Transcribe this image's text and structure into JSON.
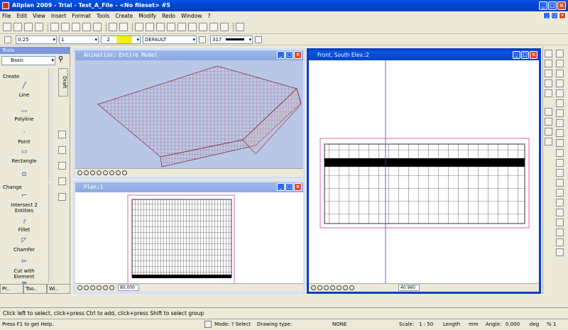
{
  "window": {
    "title": "Allplan 2009 - Trial - Test_A_File - <No fileset> #5"
  },
  "menu": [
    "File",
    "Edit",
    "View",
    "Insert",
    "Format",
    "Tools",
    "Create",
    "Modify",
    "Redo",
    "Window",
    "?"
  ],
  "format_bar": {
    "pen": "0.25",
    "line": "1",
    "color": "2",
    "layer": "DEFAULT",
    "pattern": "317"
  },
  "tools_palette": {
    "title": "Tools",
    "module": "Basic",
    "side_tab": "Draft",
    "create_label": "Create",
    "create_items": [
      "Line",
      "Polyline",
      "Point",
      "Rectangle"
    ],
    "change_label": "Change",
    "change_items": [
      "Intersect 2 Entities",
      "Fillet",
      "Chamfer",
      "Cut with Element"
    ],
    "bottom_tabs": [
      "Pr..",
      "Too..",
      "Wi.."
    ]
  },
  "windows": {
    "animation": {
      "title": "Animation: Entire Model"
    },
    "plan": {
      "title": "Plan:1",
      "zoom": "80.000"
    },
    "elevation": {
      "title": "Front, South Elev.:2",
      "zoom": "40.960"
    }
  },
  "command_line": "Click left to select, click+press Ctrl to add, click+press Shift to select group",
  "status": {
    "help": "Press F1 to get Help.",
    "mode": "Mode: ? Select",
    "drawing_type_label": "Drawing type:",
    "drawing_type": "NONE",
    "scale_label": "Scale:",
    "scale": "1 : 50",
    "length_label": "Length",
    "length_unit": "mm",
    "angle_label": "Angle:",
    "angle": "0.000",
    "angle_unit": "deg",
    "percent": "% 1"
  }
}
